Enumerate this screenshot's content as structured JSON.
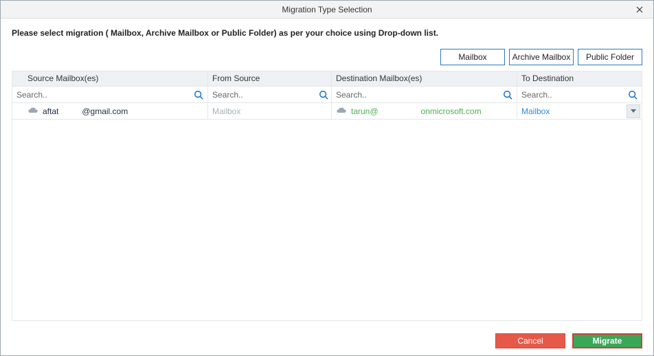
{
  "window": {
    "title": "Migration Type Selection"
  },
  "instruction": "Please select migration ( Mailbox, Archive Mailbox or Public Folder) as per your choice using Drop-down list.",
  "top_buttons": {
    "mailbox": "Mailbox",
    "archive_mailbox": "Archive Mailbox",
    "public_folder": "Public Folder"
  },
  "columns": {
    "source_mailbox": "Source Mailbox(es)",
    "from_source": "From Source",
    "destination_mailbox": "Destination Mailbox(es)",
    "to_destination": "To Destination"
  },
  "search": {
    "placeholder": "Search.."
  },
  "row": {
    "source_prefix": "aftat",
    "source_suffix": "@gmail.com",
    "from_source": "Mailbox",
    "dest_prefix": "tarun@",
    "dest_suffix": "onmicrosoft.com",
    "to_destination": "Mailbox"
  },
  "footer": {
    "cancel": "Cancel",
    "migrate": "Migrate"
  }
}
